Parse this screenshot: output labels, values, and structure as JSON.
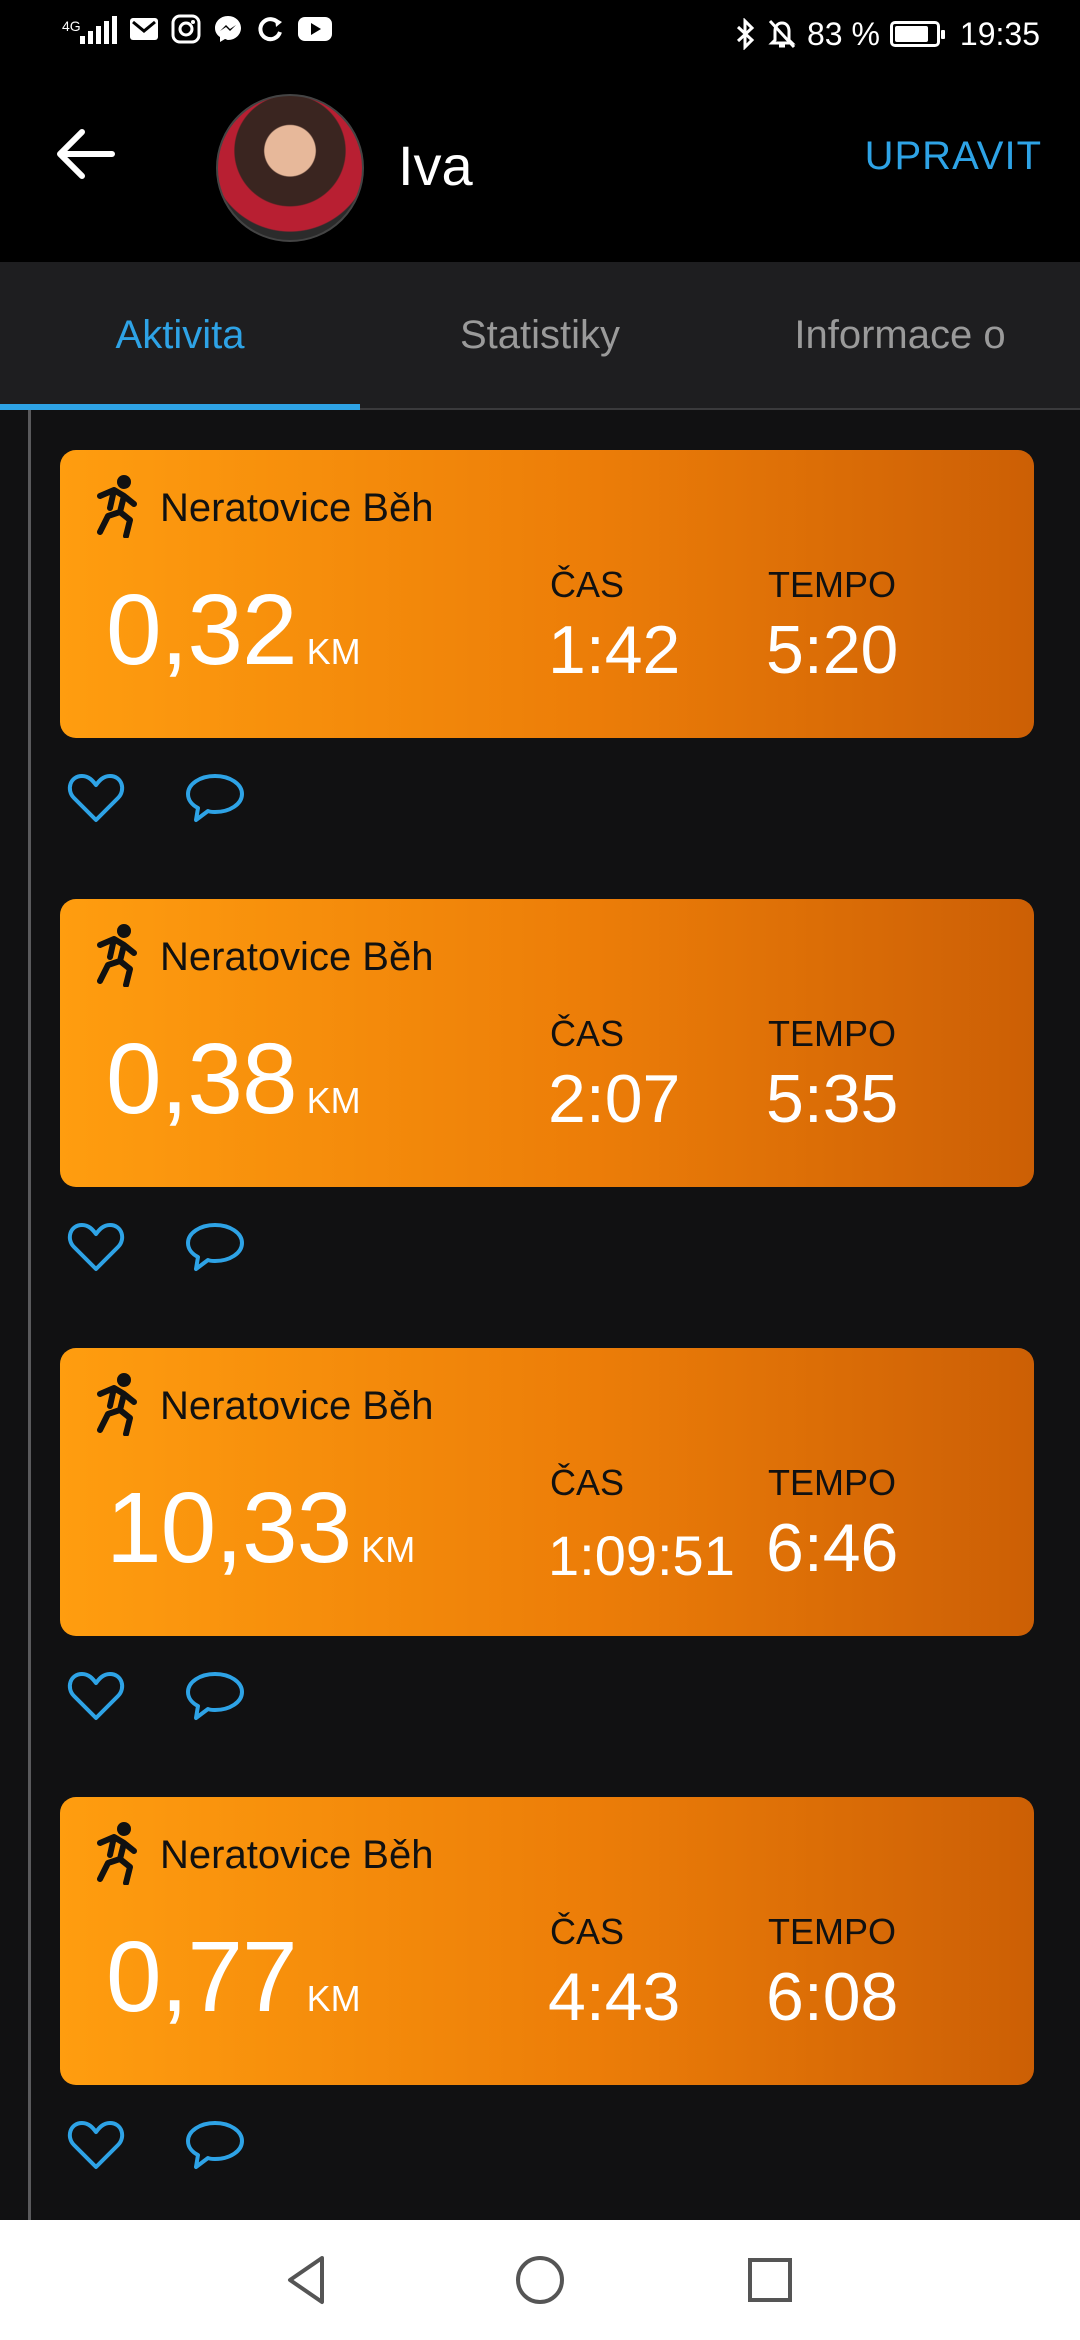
{
  "status_bar": {
    "network": "4G",
    "battery_percent": "83 %",
    "battery_level": 0.83,
    "time": "19:35",
    "icons_left": [
      "signal-icon",
      "mail-icon",
      "instagram-icon",
      "messenger-icon",
      "sync-icon",
      "youtube-icon"
    ],
    "icons_right": [
      "bluetooth-icon",
      "mute-bell-icon",
      "battery-icon"
    ]
  },
  "header": {
    "name": "Iva",
    "edit_label": "UPRAVIT"
  },
  "tabs": [
    {
      "label": "Aktivita",
      "active": true
    },
    {
      "label": "Statistiky",
      "active": false
    },
    {
      "label": "Informace o",
      "active": false
    }
  ],
  "activities": [
    {
      "title": "Neratovice Běh",
      "distance": "0,32",
      "unit": "KM",
      "time_label": "ČAS",
      "time": "1:42",
      "pace_label": "TEMPO",
      "pace": "5:20"
    },
    {
      "title": "Neratovice Běh",
      "distance": "0,38",
      "unit": "KM",
      "time_label": "ČAS",
      "time": "2:07",
      "pace_label": "TEMPO",
      "pace": "5:35"
    },
    {
      "title": "Neratovice Běh",
      "distance": "10,33",
      "unit": "KM",
      "time_label": "ČAS",
      "time": "1:09:51",
      "pace_label": "TEMPO",
      "pace": "6:46"
    },
    {
      "title": "Neratovice Běh",
      "distance": "0,77",
      "unit": "KM",
      "time_label": "ČAS",
      "time": "4:43",
      "pace_label": "TEMPO",
      "pace": "6:08"
    }
  ],
  "colors": {
    "accent": "#2ea3e6",
    "card_start": "#ff9d0f",
    "card_end": "#cc5f05",
    "background": "#111112"
  }
}
